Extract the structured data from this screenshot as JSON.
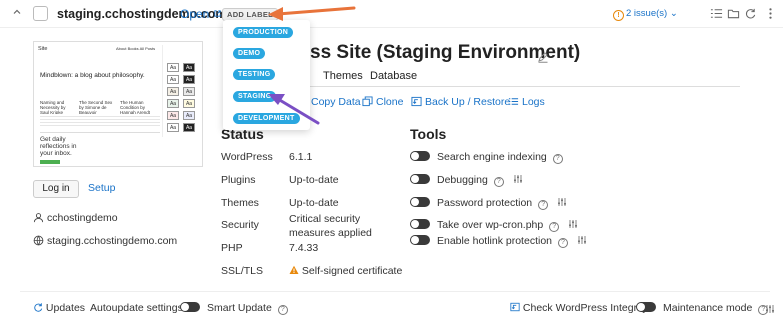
{
  "topbar": {
    "site_title": "staging.cchostingdemo.com",
    "open_label": "Open",
    "add_label": "ADD LABEL",
    "issues": "2 issue(s)",
    "issues_icon": "!",
    "chev_down": "⌄"
  },
  "label_dropdown": {
    "options": [
      "PRODUCTION",
      "DEMO",
      "TESTING",
      "STAGING",
      "DEVELOPMENT"
    ]
  },
  "thumbnail": {
    "site_tag": "Site",
    "nav": "About  Books  All Posts",
    "headline": "Mindblown: a blog about philosophy.",
    "col1_title": "Naming and Necessity by Saul Kripke",
    "col2_title": "The Second Sex by Simone de Beauvoir",
    "col3_title": "The Human Condition by Hannah Arendt",
    "cta": "Get daily reflections in your inbox.",
    "swatches": [
      "Aa",
      "Aa",
      "Aa",
      "Aa",
      "Aa",
      "Aa",
      "Aa",
      "Aa",
      "Aa",
      "Aa",
      "Aa",
      "Aa"
    ]
  },
  "left": {
    "login_label": "Log in",
    "setup_label": "Setup",
    "username": "cchostingdemo",
    "domain": "staging.cchostingdemo.com"
  },
  "main": {
    "headline_visible": "ss Site (Staging Environment)",
    "tabs": [
      "Themes",
      "Database"
    ],
    "actions": [
      "Copy Data",
      "Clone",
      "Back Up / Restore",
      "Logs"
    ]
  },
  "status": {
    "heading": "Status",
    "rows": [
      {
        "label": "WordPress",
        "value": "6.1.1"
      },
      {
        "label": "Plugins",
        "value": "Up-to-date"
      },
      {
        "label": "Themes",
        "value": "Up-to-date"
      },
      {
        "label": "Security",
        "value": "Critical security measures applied"
      },
      {
        "label": "PHP",
        "value": "7.4.33"
      },
      {
        "label": "SSL/TLS",
        "value": "Self-signed certificate"
      }
    ]
  },
  "tools": {
    "heading": "Tools",
    "rows": [
      {
        "label": "Search engine indexing",
        "has_settings": false
      },
      {
        "label": "Debugging",
        "has_settings": true
      },
      {
        "label": "Password protection",
        "has_settings": true
      },
      {
        "label": "Take over wp-cron.php",
        "has_settings": true
      },
      {
        "label": "Enable hotlink protection",
        "has_settings": true
      }
    ]
  },
  "footer": {
    "updates": "Updates",
    "autoupdate": "Autoupdate settings",
    "smart_update": "Smart Update",
    "check_integrity": "Check WordPress Integrity",
    "maintenance": "Maintenance mode"
  },
  "help_glyph": "?",
  "colors": {
    "accent": "#1a73c8",
    "pill": "#2aa7e0",
    "warning": "#e8890c",
    "arrow_orange": "#e8733a",
    "arrow_purple": "#7a4fc4"
  }
}
